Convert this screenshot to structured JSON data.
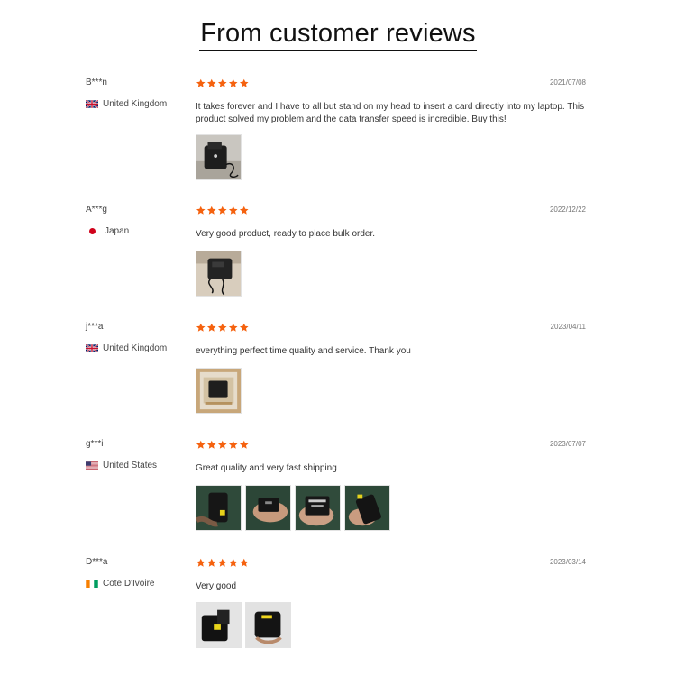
{
  "page": {
    "title": "From customer reviews"
  },
  "colors": {
    "star": "#f5620f",
    "accent_text": "#111111"
  },
  "reviews": [
    {
      "user": "B***n",
      "country": "United Kingdom",
      "flag_icon": "uk-flag-icon",
      "rating": 5,
      "date": "2021/07/08",
      "text": "It takes forever and I have to all but stand on my head to insert a card directly into my laptop. This product solved my problem and the data transfer speed is incredible. Buy this!",
      "photos": [
        "card-reader-photo"
      ]
    },
    {
      "user": "A***g",
      "country": "Japan",
      "flag_icon": "japan-flag-icon",
      "rating": 5,
      "date": "2022/12/22",
      "text": "Very good product, ready to place bulk order.",
      "photos": [
        "card-reader-photo"
      ]
    },
    {
      "user": "j***a",
      "country": "United Kingdom",
      "flag_icon": "uk-flag-icon",
      "rating": 5,
      "date": "2023/04/11",
      "text": "everything perfect time quality and service. Thank you",
      "photos": [
        "package-photo"
      ]
    },
    {
      "user": "g***i",
      "country": "United States",
      "flag_icon": "us-flag-icon",
      "rating": 5,
      "date": "2023/07/07",
      "text": "Great quality and very fast shipping",
      "photos": [
        "card-reader-photo",
        "card-reader-photo",
        "card-reader-photo",
        "card-reader-photo"
      ]
    },
    {
      "user": "D***a",
      "country": "Cote D'Ivoire",
      "flag_icon": "ivory-coast-flag-icon",
      "rating": 5,
      "date": "2023/03/14",
      "text": "Very good",
      "photos": [
        "card-reader-photo",
        "card-reader-photo"
      ]
    }
  ]
}
